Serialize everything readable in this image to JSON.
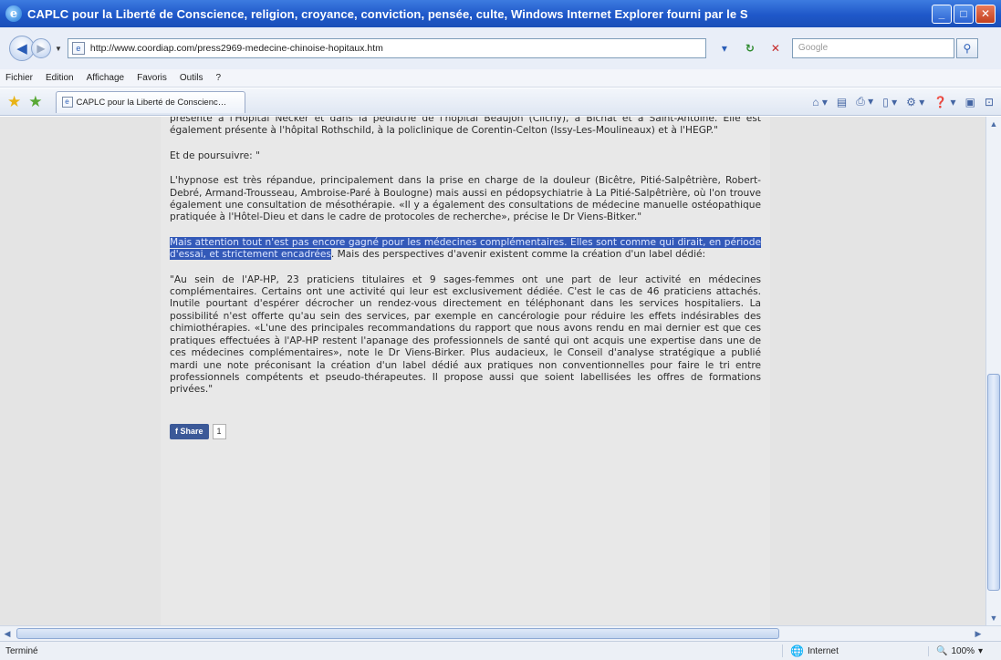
{
  "window": {
    "title": "CAPLC pour la Liberté de Conscience, religion, croyance, conviction, pensée, culte,   Windows Internet Explorer fourni par le S"
  },
  "address": {
    "url": "http://www.coordiap.com/press2969-medecine-chinoise-hopitaux.htm",
    "search_placeholder": "Google"
  },
  "menu": [
    "Fichier",
    "Edition",
    "Affichage",
    "Favoris",
    "Outils",
    "?"
  ],
  "tab": {
    "label": "CAPLC pour la Liberté de Conscience, religion, croyan..."
  },
  "article": {
    "p1": "présente à l'Hôpital Necker et dans la pédiatrie de l'hôpital Beaujon (Clichy), à Bichat et à Saint-Antoine. Elle est également présente à l'hôpital Rothschild, à la policlinique de Corentin-Celton (Issy-Les-Moulineaux) et à l'HEGP.\"",
    "p2": "Et de poursuivre: \"",
    "p3": "L'hypnose est très répandue, principalement dans la prise en charge de la douleur (Bicêtre, Pitié-Salpêtrière, Robert-Debré, Armand-Trousseau, Ambroise-Paré à Boulogne) mais aussi en pédopsychiatrie à La Pitié-Salpêtrière, où l'on trouve également une consultation de mésothérapie. «Il y a également des consultations de médecine manuelle ostéopathique pratiquée à l'Hôtel-Dieu et dans le cadre de protocoles de recherche», précise le Dr Viens-Bitker.\"",
    "p4_highlight": "Mais attention tout n'est pas encore gagné pour les médecines complémentaires. Elles sont comme qui dirait, en période d'essai, et strictement encadrées",
    "p4_rest": ". Mais des perspectives d'avenir existent comme la création d'un label dédié:",
    "p5": "\"Au sein de l'AP-HP, 23 praticiens titulaires et 9 sages-femmes ont une part de leur activité en médecines complémentaires. Certains ont une activité qui leur est exclusivement dédiée. C'est le cas de 46 praticiens attachés. Inutile pourtant d'espérer décrocher un rendez-vous directement en téléphonant dans les services hospitaliers. La possibilité n'est offerte qu'au sein des services, par exemple en cancérologie pour réduire les effets indésirables des chimiothérapies. «L'une des principales recommandations du rapport que nous avons rendu en mai dernier est que ces pratiques effectuées à l'AP-HP restent l'apanage des professionnels de santé qui ont acquis une expertise dans une de ces médecines complémentaires», note le Dr Viens-Birker. Plus audacieux, le Conseil d'analyse stratégique a publié mardi une note préconisant la création d'un label dédié aux pratiques non conventionnelles pour faire le tri entre professionnels compétents et pseudo-thérapeutes. Il propose aussi que soient labellisées les offres de formations privées.\""
  },
  "share": {
    "label": "Share",
    "count": "1"
  },
  "status": {
    "left": "Terminé",
    "zone": "Internet",
    "zoom": "100%"
  }
}
